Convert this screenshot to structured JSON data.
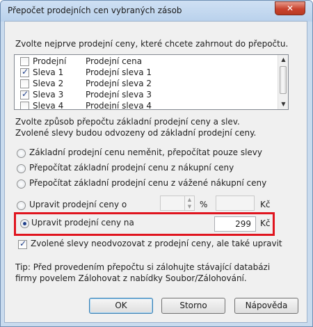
{
  "window": {
    "title": "Přepočet prodejních cen vybraných zásob",
    "close_glyph": "✕"
  },
  "intro": "Zvolte nejprve prodejní ceny, které chcete zahrnout do přepočtu.",
  "list": {
    "rows": [
      {
        "code": "Prodejní",
        "name": "Prodejní cena",
        "checked": false
      },
      {
        "code": "Sleva 1",
        "name": "Prodejní sleva 1",
        "checked": true
      },
      {
        "code": "Sleva 2",
        "name": "Prodejní sleva 2",
        "checked": false
      },
      {
        "code": "Sleva 3",
        "name": "Prodejní sleva 3",
        "checked": true
      },
      {
        "code": "Sleva 4",
        "name": "Prodejní sleva 4",
        "checked": false
      }
    ]
  },
  "method": {
    "line1": "Zvolte způsob přepočtu základní prodejní ceny a slev.",
    "line2": "Zvolené slevy budou odvozeny od základní prodejní ceny.",
    "options": [
      "Základní prodejní cenu neměnit, přepočítat pouze slevy",
      "Přepočítat základní prodejní cenu z nákupní ceny",
      "Přepočítat základní prodejní cenu z vážené nákupní ceny"
    ]
  },
  "adjust_by": {
    "label": "Upravit prodejní ceny o",
    "percent_unit": "%",
    "currency": "Kč",
    "percent_value": "",
    "amount_value": ""
  },
  "adjust_to": {
    "label": "Upravit prodejní ceny na",
    "value": "299",
    "currency": "Kč",
    "selected": true
  },
  "also_adjust": {
    "label": "Zvolené slevy neodvozovat z prodejní ceny, ale také upravit",
    "checked": true
  },
  "tip": {
    "line1": "Tip: Před provedením přepočtu si zálohujte stávající databázi",
    "line2": "firmy povelem Zálohovat z nabídky Soubor/Zálohování."
  },
  "buttons": {
    "ok": "OK",
    "cancel": "Storno",
    "help": "Nápověda"
  },
  "colors": {
    "highlight": "#e0141e",
    "accent": "#1f3f8a"
  }
}
